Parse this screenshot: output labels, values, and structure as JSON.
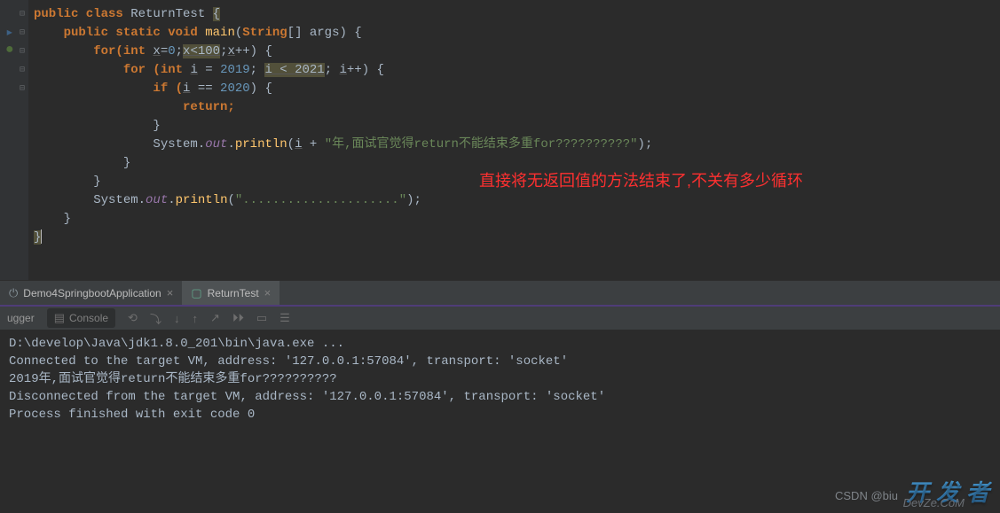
{
  "code": {
    "l1_pre": "public class ",
    "l1_cls": "ReturnTest ",
    "l1_br": "{",
    "l2_pre": "    public static void ",
    "l2_mth": "main",
    "l2_par": "(",
    "l2_kw2": "String",
    "l2_arr": "[] args) {",
    "l3_pre": "        for(int ",
    "l3_v1": "x",
    "l3_eq": "=",
    "l3_n0": "0",
    "l3_semi": ";",
    "l3_cond": "x<100",
    "l3_semi2": ";",
    "l3_inc": "x",
    "l3_pp": "++) {",
    "l4_pre": "            for (int ",
    "l4_v": "i",
    "l4_eq": " = ",
    "l4_n": "2019",
    "l4_semi": "; ",
    "l4_cond": "i < 2021",
    "l4_semi2": "; ",
    "l4_inc": "i",
    "l4_pp": "++) {",
    "l5_pre": "                if (",
    "l5_v": "i",
    "l5_eq": " == ",
    "l5_n": "2020",
    "l5_cl": ") {",
    "l6_ret": "                    return;",
    "l7": "                }",
    "l8_pre": "                System.",
    "l8_out": "out",
    "l8_dot": ".",
    "l8_pr": "println",
    "l8_op": "(",
    "l8_v": "i",
    "l8_pl": " + ",
    "l8_str": "\"年,面试官觉得return不能结束多重for??????????\"",
    "l8_cl": ");",
    "l9": "            }",
    "l10": "        }",
    "l11_pre": "        System.",
    "l11_out": "out",
    "l11_dot": ".",
    "l11_pr": "println",
    "l11_op": "(",
    "l11_str": "\".....................\"",
    "l11_cl": ");",
    "l12": "    }",
    "l13": "}"
  },
  "annotation": "直接将无返回值的方法结束了,不关有多少循环",
  "tabs": {
    "run1": "Demo4SpringbootApplication",
    "run2": "ReturnTest"
  },
  "debug": {
    "debugger": "ugger",
    "console": "Console"
  },
  "console": {
    "l1": "D:\\develop\\Java\\jdk1.8.0_201\\bin\\java.exe ...",
    "l2": "Connected to the target VM, address: '127.0.0.1:57084', transport: 'socket'",
    "l3": "2019年,面试官觉得return不能结束多重for??????????",
    "l4": "Disconnected from the target VM, address: '127.0.0.1:57084', transport: 'socket'",
    "l5": "",
    "l6": "Process finished with exit code 0"
  },
  "watermark": {
    "main": "开发者",
    "sub": "DevZe.CoM",
    "csdn": "CSDN @biu"
  }
}
